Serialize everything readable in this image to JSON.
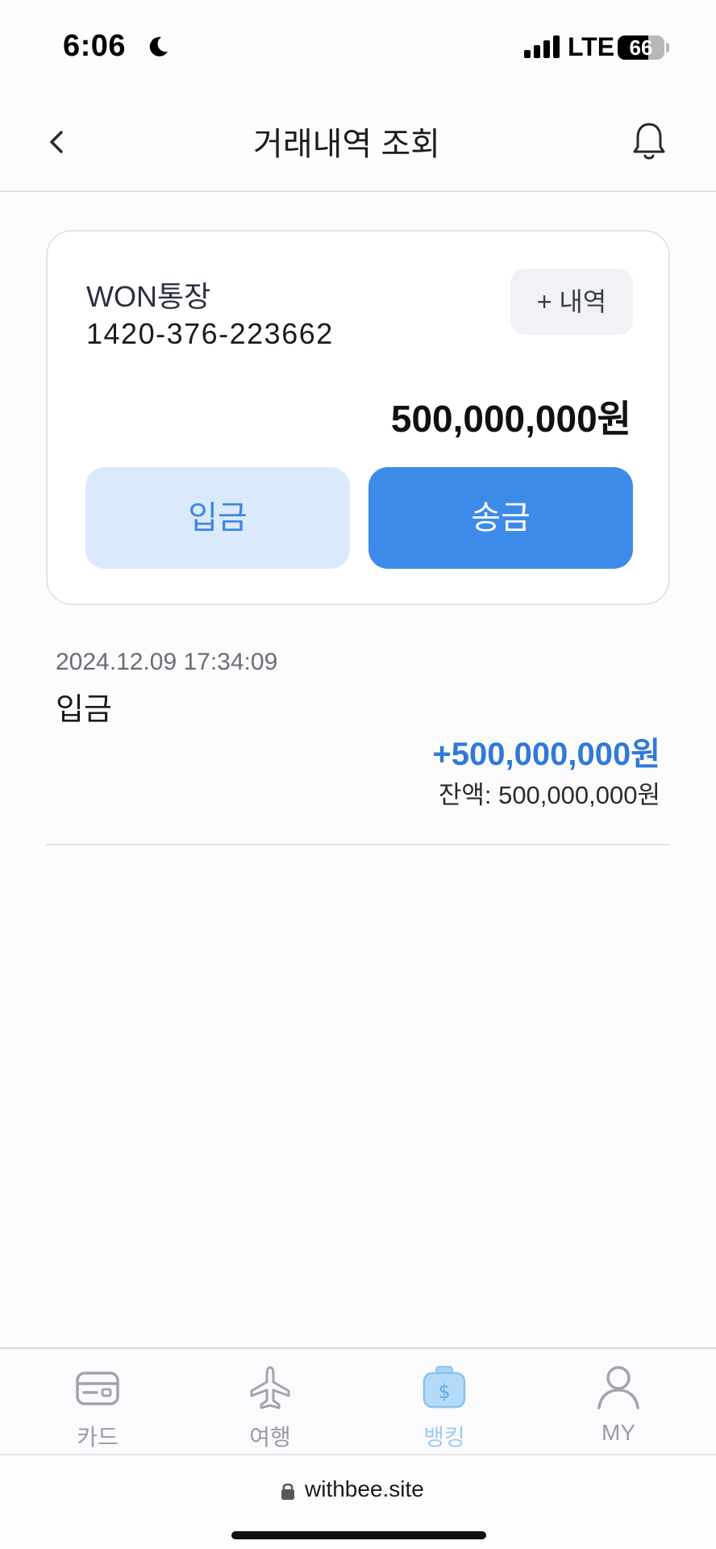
{
  "status_bar": {
    "time": "6:06",
    "network": "LTE",
    "battery_level": "66",
    "battery_fraction": 0.66
  },
  "header": {
    "title": "거래내역 조회"
  },
  "account": {
    "name": "WON통장",
    "number": "1420-376-223662",
    "history_button": "+ 내역",
    "balance": "500,000,000원",
    "deposit_button": "입금",
    "transfer_button": "송금"
  },
  "transactions": [
    {
      "datetime": "2024.12.09 17:34:09",
      "type": "입금",
      "amount": "+500,000,000원",
      "balance_after": "잔액: 500,000,000원"
    }
  ],
  "bottom_nav": {
    "items": [
      {
        "label": "카드",
        "icon": "card-icon",
        "active": false
      },
      {
        "label": "여행",
        "icon": "airplane-icon",
        "active": false
      },
      {
        "label": "뱅킹",
        "icon": "money-bag-icon",
        "active": true
      },
      {
        "label": "MY",
        "icon": "person-icon",
        "active": false
      }
    ]
  },
  "browser": {
    "url": "withbee.site"
  },
  "colors": {
    "accent": "#3d8be9",
    "accent_light": "#dbe9fc",
    "amount_positive": "#2f7ad7"
  }
}
